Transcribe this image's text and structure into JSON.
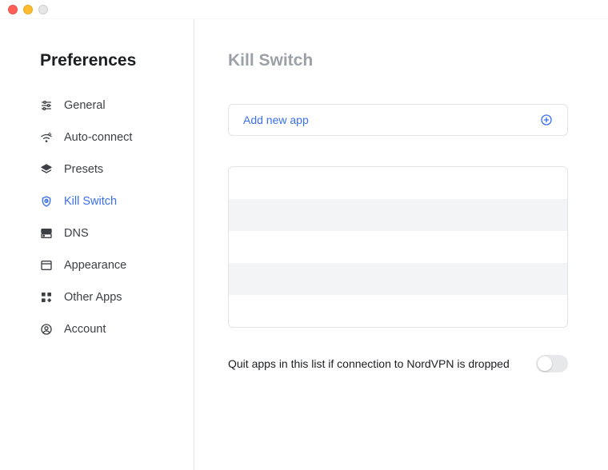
{
  "sidebar": {
    "title": "Preferences",
    "items": [
      {
        "label": "General",
        "icon": "sliders-icon"
      },
      {
        "label": "Auto-connect",
        "icon": "wifi-spark-icon"
      },
      {
        "label": "Presets",
        "icon": "layers-icon"
      },
      {
        "label": "Kill Switch",
        "icon": "shield-clock-icon"
      },
      {
        "label": "DNS",
        "icon": "server-icon"
      },
      {
        "label": "Appearance",
        "icon": "window-icon"
      },
      {
        "label": "Other Apps",
        "icon": "apps-grid-icon"
      },
      {
        "label": "Account",
        "icon": "user-circle-icon"
      }
    ],
    "active_index": 3
  },
  "main": {
    "title": "Kill Switch",
    "add_button_label": "Add new app",
    "app_rows": 5,
    "footer": {
      "label": "Quit apps in this list if connection to NordVPN is dropped",
      "toggle_on": false
    }
  },
  "colors": {
    "accent": "#3a6ff0",
    "muted_title": "#9ca1a8",
    "border": "#e1e3e6"
  }
}
